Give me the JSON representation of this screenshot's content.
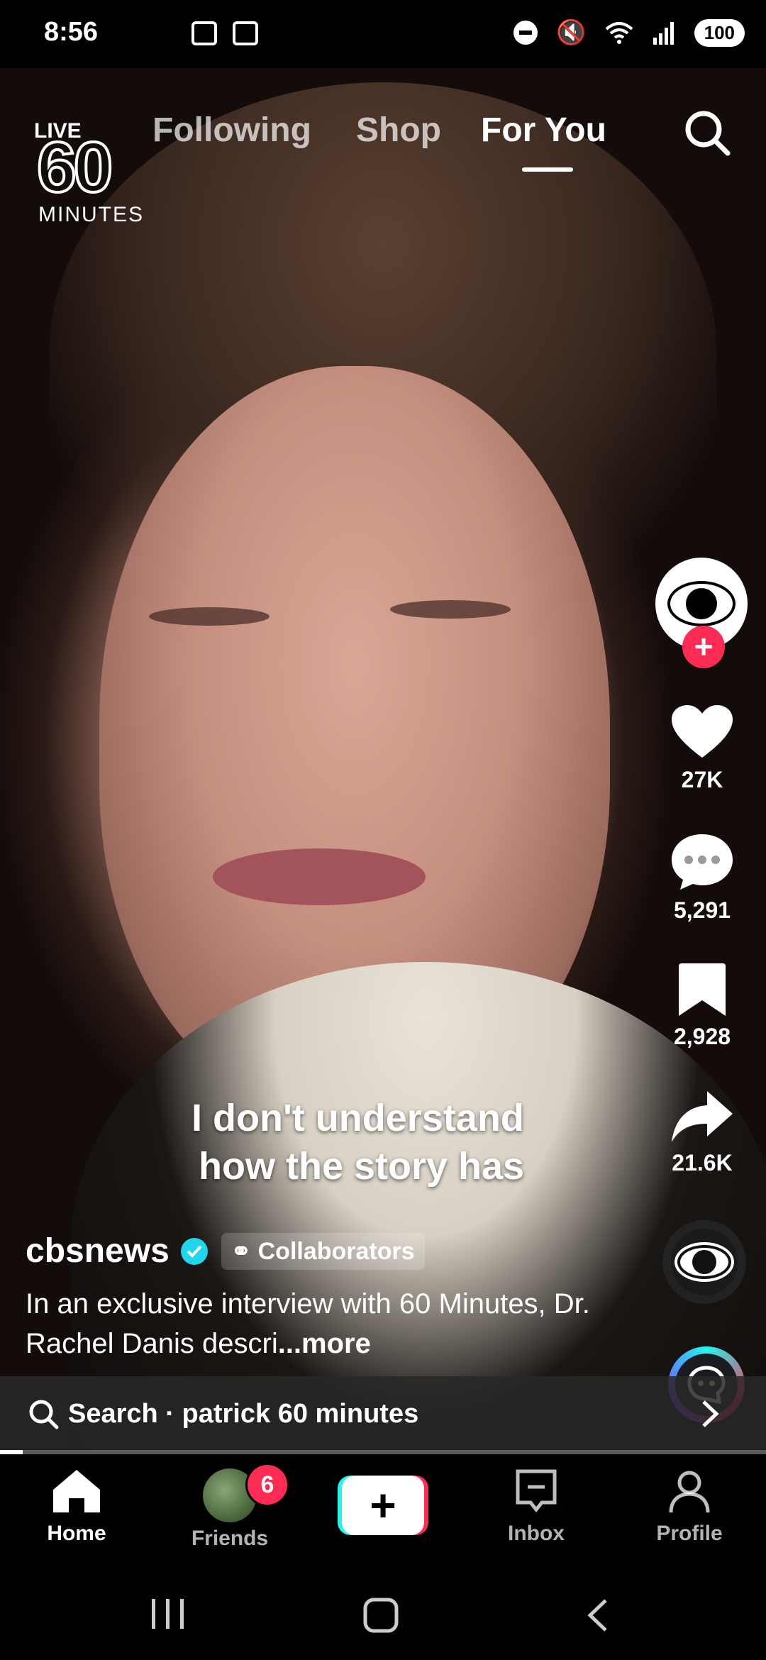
{
  "status_bar": {
    "time": "8:56",
    "battery": "100"
  },
  "top_nav": {
    "live_badge": "LIVE",
    "logo_number": "60",
    "logo_word": "MINUTES",
    "tabs": [
      {
        "label": "Following"
      },
      {
        "label": "Shop"
      },
      {
        "label": "For You",
        "active": true
      }
    ]
  },
  "video": {
    "caption_line1": "I don't understand",
    "caption_line2": "how the story has"
  },
  "actions": {
    "likes": "27K",
    "comments": "5,291",
    "saves": "2,928",
    "shares": "21.6K"
  },
  "post": {
    "username": "cbsnews",
    "collab_label": "Collaborators",
    "description": "In an exclusive interview with 60 Minutes, Dr. Rachel Danis descri",
    "more_label": "...more"
  },
  "search_suggestion": {
    "text": "Search · patrick 60 minutes"
  },
  "progress": {
    "value": 0.03
  },
  "tab_bar": {
    "home": "Home",
    "friends": "Friends",
    "friends_badge": "6",
    "create": "+",
    "inbox": "Inbox",
    "profile": "Profile"
  },
  "colors": {
    "accent_red": "#fe2c55",
    "accent_cyan": "#25f4ee",
    "verified": "#20d5ec"
  },
  "icons": [
    "search-icon",
    "heart-icon",
    "comment-icon",
    "bookmark-icon",
    "share-icon",
    "home-icon",
    "inbox-icon",
    "profile-icon"
  ]
}
